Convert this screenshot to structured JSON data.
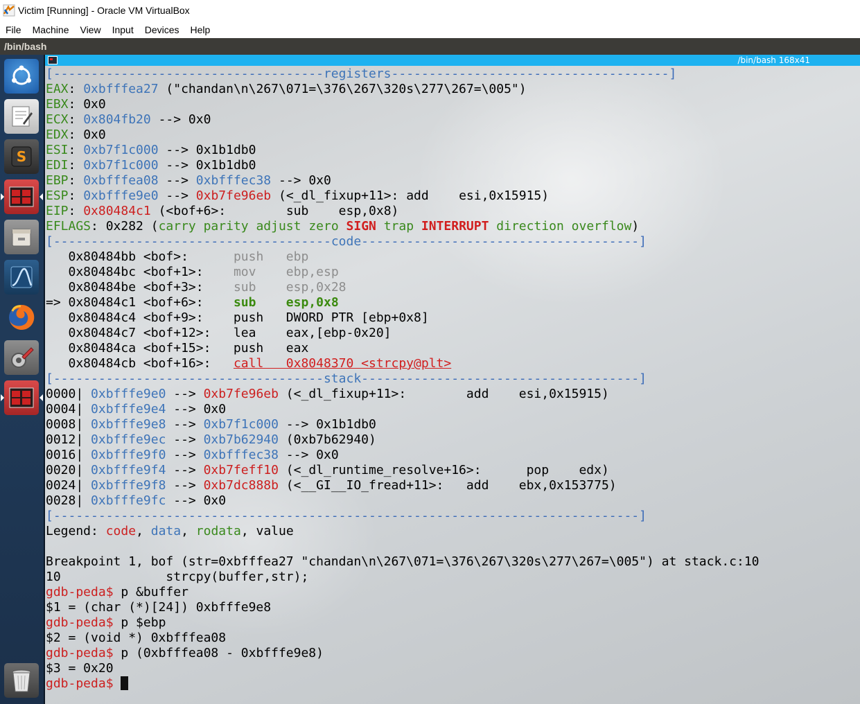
{
  "window": {
    "title": "Victim [Running] - Oracle VM VirtualBox",
    "menu": [
      "File",
      "Machine",
      "View",
      "Input",
      "Devices",
      "Help"
    ]
  },
  "guest_title": "/bin/bash",
  "launcher": [
    {
      "name": "ubuntu-logo-icon"
    },
    {
      "name": "text-editor-icon"
    },
    {
      "name": "sublime-text-icon"
    },
    {
      "name": "terminal-icon"
    },
    {
      "name": "file-manager-icon"
    },
    {
      "name": "wireshark-icon"
    },
    {
      "name": "firefox-icon"
    },
    {
      "name": "system-settings-icon"
    },
    {
      "name": "terminal-icon-2"
    },
    {
      "name": "trash-icon"
    }
  ],
  "terminal": {
    "title": "/bin/bash 168x41",
    "lines": [
      [
        [
          "c-border",
          "[------------------------------------"
        ],
        [
          "c-blue",
          "registers"
        ],
        [
          "c-border",
          "-------------------------------------]"
        ]
      ],
      [
        [
          "c-green",
          "EAX"
        ],
        [
          "c-black",
          ": "
        ],
        [
          "c-blue",
          "0xbfffea27"
        ],
        [
          "c-black",
          " (\"chandan\\n\\267\\071=\\376\\267\\320s\\277\\267=\\005\")"
        ]
      ],
      [
        [
          "c-green",
          "EBX"
        ],
        [
          "c-black",
          ": 0x0"
        ]
      ],
      [
        [
          "c-green",
          "ECX"
        ],
        [
          "c-black",
          ": "
        ],
        [
          "c-blue",
          "0x804fb20"
        ],
        [
          "c-black",
          " --> 0x0"
        ]
      ],
      [
        [
          "c-green",
          "EDX"
        ],
        [
          "c-black",
          ": 0x0"
        ]
      ],
      [
        [
          "c-green",
          "ESI"
        ],
        [
          "c-black",
          ": "
        ],
        [
          "c-blue",
          "0xb7f1c000"
        ],
        [
          "c-black",
          " --> 0x1b1db0"
        ]
      ],
      [
        [
          "c-green",
          "EDI"
        ],
        [
          "c-black",
          ": "
        ],
        [
          "c-blue",
          "0xb7f1c000"
        ],
        [
          "c-black",
          " --> 0x1b1db0"
        ]
      ],
      [
        [
          "c-green",
          "EBP"
        ],
        [
          "c-black",
          ": "
        ],
        [
          "c-blue",
          "0xbfffea08"
        ],
        [
          "c-black",
          " --> "
        ],
        [
          "c-blue",
          "0xbfffec38"
        ],
        [
          "c-black",
          " --> 0x0"
        ]
      ],
      [
        [
          "c-green",
          "ESP"
        ],
        [
          "c-black",
          ": "
        ],
        [
          "c-blue",
          "0xbfffe9e0"
        ],
        [
          "c-black",
          " --> "
        ],
        [
          "c-red",
          "0xb7fe96eb"
        ],
        [
          "c-black",
          " (<_dl_fixup+11>: add    esi,0x15915)"
        ]
      ],
      [
        [
          "c-green",
          "EIP"
        ],
        [
          "c-black",
          ": "
        ],
        [
          "c-red",
          "0x80484c1"
        ],
        [
          "c-black",
          " (<bof+6>:        sub    esp,0x8)"
        ]
      ],
      [
        [
          "c-green",
          "EFLAGS"
        ],
        [
          "c-black",
          ": 0x282 ("
        ],
        [
          "c-green",
          "carry parity adjust zero "
        ],
        [
          "c-boldred",
          "SIGN"
        ],
        [
          "c-green",
          " trap "
        ],
        [
          "c-boldred",
          "INTERRUPT"
        ],
        [
          "c-green",
          " direction overflow"
        ],
        [
          "c-black",
          ")"
        ]
      ],
      [
        [
          "c-border",
          "[-------------------------------------"
        ],
        [
          "c-blue",
          "code"
        ],
        [
          "c-border",
          "-------------------------------------]"
        ]
      ],
      [
        [
          "c-black",
          "   0x80484bb <bof>:      "
        ],
        [
          "c-gray",
          "push   ebp"
        ]
      ],
      [
        [
          "c-black",
          "   0x80484bc <bof+1>:    "
        ],
        [
          "c-gray",
          "mov    ebp,esp"
        ]
      ],
      [
        [
          "c-black",
          "   0x80484be <bof+3>:    "
        ],
        [
          "c-gray",
          "sub    esp,0x28"
        ]
      ],
      [
        [
          "c-black",
          "=> 0x80484c1 <bof+6>:    "
        ],
        [
          "c-boldgreen",
          "sub    esp,0x8"
        ]
      ],
      [
        [
          "c-black",
          "   0x80484c4 <bof+9>:    push   DWORD PTR [ebp+0x8]"
        ]
      ],
      [
        [
          "c-black",
          "   0x80484c7 <bof+12>:   lea    eax,[ebp-0x20]"
        ]
      ],
      [
        [
          "c-black",
          "   0x80484ca <bof+15>:   push   eax"
        ]
      ],
      [
        [
          "c-black",
          "   0x80484cb <bof+16>:   "
        ],
        [
          "c-underred",
          "call   0x8048370 <strcpy@plt>"
        ]
      ],
      [
        [
          "c-border",
          "[------------------------------------"
        ],
        [
          "c-blue",
          "stack"
        ],
        [
          "c-border",
          "-------------------------------------]"
        ]
      ],
      [
        [
          "c-black",
          "0000| "
        ],
        [
          "c-blue",
          "0xbfffe9e0"
        ],
        [
          "c-black",
          " --> "
        ],
        [
          "c-red",
          "0xb7fe96eb"
        ],
        [
          "c-black",
          " (<_dl_fixup+11>:        add    esi,0x15915)"
        ]
      ],
      [
        [
          "c-black",
          "0004| "
        ],
        [
          "c-blue",
          "0xbfffe9e4"
        ],
        [
          "c-black",
          " --> 0x0"
        ]
      ],
      [
        [
          "c-black",
          "0008| "
        ],
        [
          "c-blue",
          "0xbfffe9e8"
        ],
        [
          "c-black",
          " --> "
        ],
        [
          "c-blue",
          "0xb7f1c000"
        ],
        [
          "c-black",
          " --> 0x1b1db0"
        ]
      ],
      [
        [
          "c-black",
          "0012| "
        ],
        [
          "c-blue",
          "0xbfffe9ec"
        ],
        [
          "c-black",
          " --> "
        ],
        [
          "c-blue",
          "0xb7b62940"
        ],
        [
          "c-black",
          " (0xb7b62940)"
        ]
      ],
      [
        [
          "c-black",
          "0016| "
        ],
        [
          "c-blue",
          "0xbfffe9f0"
        ],
        [
          "c-black",
          " --> "
        ],
        [
          "c-blue",
          "0xbfffec38"
        ],
        [
          "c-black",
          " --> 0x0"
        ]
      ],
      [
        [
          "c-black",
          "0020| "
        ],
        [
          "c-blue",
          "0xbfffe9f4"
        ],
        [
          "c-black",
          " --> "
        ],
        [
          "c-red",
          "0xb7feff10"
        ],
        [
          "c-black",
          " (<_dl_runtime_resolve+16>:      pop    edx)"
        ]
      ],
      [
        [
          "c-black",
          "0024| "
        ],
        [
          "c-blue",
          "0xbfffe9f8"
        ],
        [
          "c-black",
          " --> "
        ],
        [
          "c-red",
          "0xb7dc888b"
        ],
        [
          "c-black",
          " (<__GI__IO_fread+11>:   add    ebx,0x153775)"
        ]
      ],
      [
        [
          "c-black",
          "0028| "
        ],
        [
          "c-blue",
          "0xbfffe9fc"
        ],
        [
          "c-black",
          " --> 0x0"
        ]
      ],
      [
        [
          "c-border",
          "[------------------------------------------------------------------------------]"
        ]
      ],
      [
        [
          "c-black",
          "Legend: "
        ],
        [
          "c-red",
          "code"
        ],
        [
          "c-black",
          ", "
        ],
        [
          "c-blue",
          "data"
        ],
        [
          "c-black",
          ", "
        ],
        [
          "c-green",
          "rodata"
        ],
        [
          "c-black",
          ", value"
        ]
      ],
      [
        [
          "c-black",
          ""
        ]
      ],
      [
        [
          "c-black",
          "Breakpoint 1, bof (str=0xbfffea27 \"chandan\\n\\267\\071=\\376\\267\\320s\\277\\267=\\005\") at stack.c:10"
        ]
      ],
      [
        [
          "c-black",
          "10              strcpy(buffer,str);"
        ]
      ],
      [
        [
          "c-red",
          "gdb-peda$"
        ],
        [
          "c-black",
          " p &buffer"
        ]
      ],
      [
        [
          "c-black",
          "$1 = (char (*)[24]) 0xbfffe9e8"
        ]
      ],
      [
        [
          "c-red",
          "gdb-peda$"
        ],
        [
          "c-black",
          " p $ebp"
        ]
      ],
      [
        [
          "c-black",
          "$2 = (void *) 0xbfffea08"
        ]
      ],
      [
        [
          "c-red",
          "gdb-peda$"
        ],
        [
          "c-black",
          " p (0xbfffea08 - 0xbfffe9e8)"
        ]
      ],
      [
        [
          "c-black",
          "$3 = 0x20"
        ]
      ],
      [
        [
          "c-red",
          "gdb-peda$"
        ],
        [
          "c-black",
          " "
        ]
      ]
    ]
  }
}
